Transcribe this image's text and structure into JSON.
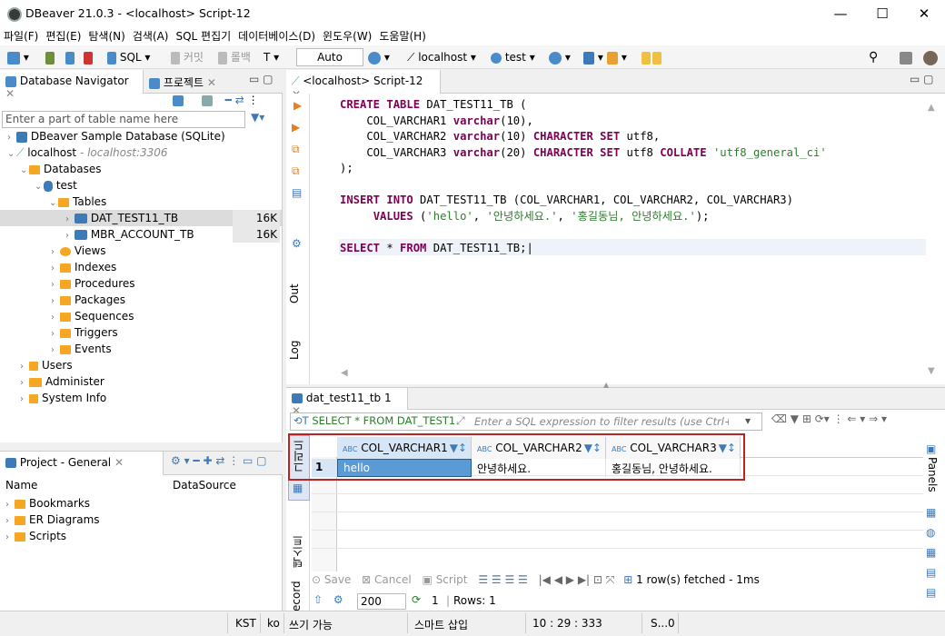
{
  "window": {
    "title": "DBeaver 21.0.3 - <localhost> Script-12"
  },
  "menu": [
    "파일(F)",
    "편집(E)",
    "탐색(N)",
    "검색(A)",
    "SQL 편집기",
    "데이터베이스(D)",
    "윈도우(W)",
    "도움말(H)"
  ],
  "toolbar": {
    "sql": "SQL",
    "commit": "커밋",
    "rollback": "롤백",
    "txmode": "Auto",
    "connection": "localhost",
    "schema": "test"
  },
  "navigator": {
    "tab1": "Database Navigator",
    "tab2": "프로젝트",
    "filter_placeholder": "Enter a part of table name here",
    "items": {
      "sample": "DBeaver Sample Database (SQLite)",
      "localhost": "localhost",
      "localhost_hint": "- localhost:3306",
      "databases": "Databases",
      "test": "test",
      "tables": "Tables",
      "t1": "DAT_TEST11_TB",
      "t1size": "16K",
      "t2": "MBR_ACCOUNT_TB",
      "t2size": "16K",
      "views": "Views",
      "indexes": "Indexes",
      "procedures": "Procedures",
      "packages": "Packages",
      "sequences": "Sequences",
      "triggers": "Triggers",
      "events": "Events",
      "users": "Users",
      "administer": "Administer",
      "sysinfo": "System Info"
    }
  },
  "project": {
    "tab": "Project - General",
    "col_name": "Name",
    "col_ds": "DataSource",
    "items": [
      "Bookmarks",
      "ER Diagrams",
      "Scripts"
    ]
  },
  "editor": {
    "tab": "<localhost> Script-12",
    "side_out": "Out",
    "side_log": "Log"
  },
  "results": {
    "tab": "dat_test11_tb 1",
    "query": "SELECT * FROM DAT_TEST1",
    "filter_placeholder": "Enter a SQL expression to filter results (use Ctrl+S",
    "side_grid": "그리드",
    "side_text": "텍스트",
    "side_record": "ecord",
    "columns": [
      "COL_VARCHAR1",
      "COL_VARCHAR2",
      "COL_VARCHAR3"
    ],
    "col_prefix": "ABC",
    "row_num": "1",
    "row": [
      "hello",
      "안녕하세요.",
      "홍길동님, 안녕하세요."
    ],
    "save": "Save",
    "cancel": "Cancel",
    "script": "Script",
    "fetched": "1 row(s) fetched - 1ms",
    "limit": "200",
    "refresh_count": "1",
    "rows": "Rows: 1",
    "panels": "Panels"
  },
  "status": {
    "tz": "KST",
    "lang": "ko",
    "mode": "쓰기 가능",
    "insert": "스마트 삽입",
    "pos": "10 : 29 : 333",
    "extra": "S...0"
  }
}
